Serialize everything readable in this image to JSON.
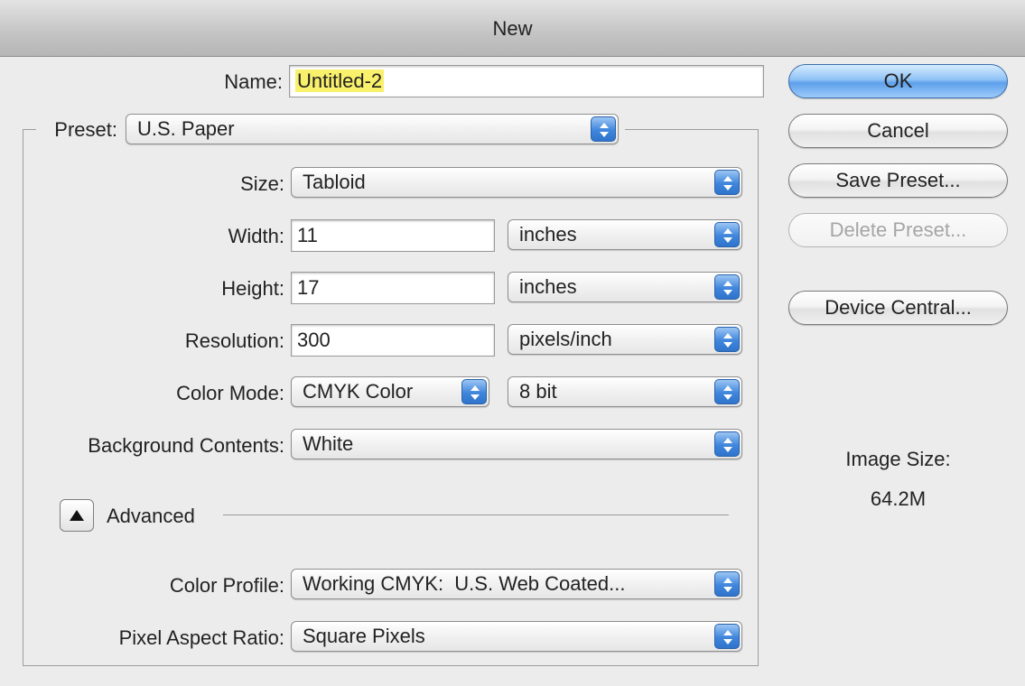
{
  "window": {
    "title": "New"
  },
  "form": {
    "name_label": "Name:",
    "name_value": "Untitled-2",
    "preset_label": "Preset:",
    "preset_value": "U.S. Paper",
    "size_label": "Size:",
    "size_value": "Tabloid",
    "width_label": "Width:",
    "width_value": "11",
    "width_unit": "inches",
    "height_label": "Height:",
    "height_value": "17",
    "height_unit": "inches",
    "resolution_label": "Resolution:",
    "resolution_value": "300",
    "resolution_unit": "pixels/inch",
    "color_mode_label": "Color Mode:",
    "color_mode_value": "CMYK Color",
    "bit_depth_value": "8 bit",
    "background_label": "Background Contents:",
    "background_value": "White",
    "advanced_label": "Advanced",
    "color_profile_label": "Color Profile:",
    "color_profile_value": "Working CMYK:  U.S. Web Coated...",
    "pixel_aspect_label": "Pixel Aspect Ratio:",
    "pixel_aspect_value": "Square Pixels"
  },
  "buttons": {
    "ok": "OK",
    "cancel": "Cancel",
    "save_preset": "Save Preset...",
    "delete_preset": "Delete Preset...",
    "device_central": "Device Central..."
  },
  "info": {
    "image_size_label": "Image Size:",
    "image_size_value": "64.2M"
  },
  "icons": {
    "popup_arrows": "up-down-arrows-icon",
    "disclosure": "triangle-up-icon"
  },
  "colors": {
    "name_highlight": "#f9f06b",
    "accent_blue": "#3f86dc"
  }
}
